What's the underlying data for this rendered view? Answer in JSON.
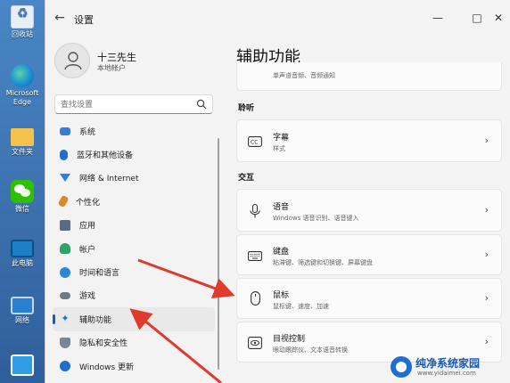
{
  "desktop": {
    "icons": [
      {
        "label": "回收站",
        "icon": "recycle-bin-icon"
      },
      {
        "label": "Microsoft Edge",
        "icon": "edge-icon"
      },
      {
        "label": "文件夹",
        "icon": "folder-icon"
      },
      {
        "label": "微信",
        "icon": "wechat-icon"
      },
      {
        "label": "此电脑",
        "icon": "computer-icon"
      },
      {
        "label": "网络",
        "icon": "network-icon"
      },
      {
        "label": "",
        "icon": "control-panel-icon"
      }
    ]
  },
  "window": {
    "title": "设置",
    "controls": {
      "minimize": "—",
      "maximize": "□",
      "close": "✕"
    }
  },
  "profile": {
    "name": "十三先生",
    "account_type": "本地帐户"
  },
  "search": {
    "placeholder": "查找设置"
  },
  "sidebar": {
    "items": [
      {
        "label": "系统",
        "icon": "system-icon",
        "color": "#3a7bd5"
      },
      {
        "label": "蓝牙和其他设备",
        "icon": "bluetooth-icon",
        "color": "#1f6fd0"
      },
      {
        "label": "网络 & Internet",
        "icon": "wifi-icon",
        "color": "#2b7de9"
      },
      {
        "label": "个性化",
        "icon": "brush-icon",
        "color": "#d88a2e"
      },
      {
        "label": "应用",
        "icon": "apps-icon",
        "color": "#5a6b82"
      },
      {
        "label": "帐户",
        "icon": "account-icon",
        "color": "#2fa36b"
      },
      {
        "label": "时间和语言",
        "icon": "globe-clock-icon",
        "color": "#2b8ad6"
      },
      {
        "label": "游戏",
        "icon": "gamepad-icon",
        "color": "#6f7a86"
      },
      {
        "label": "辅助功能",
        "icon": "accessibility-icon",
        "color": "#1f6fd0",
        "active": true
      },
      {
        "label": "隐私和安全性",
        "icon": "shield-icon",
        "color": "#7a8694"
      },
      {
        "label": "Windows 更新",
        "icon": "update-icon",
        "color": "#1f6fd0"
      }
    ]
  },
  "main": {
    "title": "辅助功能",
    "partial_card": {
      "subtitle": "单声道音频、音频通知"
    },
    "sections": [
      {
        "label": "聆听",
        "cards": [
          {
            "title": "字幕",
            "subtitle": "样式",
            "icon": "captions-icon"
          }
        ]
      },
      {
        "label": "交互",
        "cards": [
          {
            "title": "语音",
            "subtitle": "Windows 语音识别、语音键入",
            "icon": "microphone-icon"
          },
          {
            "title": "键盘",
            "subtitle": "粘滞键、筛选键和切换键、屏幕键盘",
            "icon": "keyboard-icon"
          },
          {
            "title": "鼠标",
            "subtitle": "鼠标键、速度、加速",
            "icon": "mouse-icon"
          },
          {
            "title": "目视控制",
            "subtitle": "眼动跟踪仪、文本语音转换",
            "icon": "eye-control-icon"
          }
        ]
      }
    ]
  },
  "watermark": {
    "name": "纯净系统家园",
    "url": "www.yidaimei.com"
  },
  "annotation_color": "#e03a2f"
}
